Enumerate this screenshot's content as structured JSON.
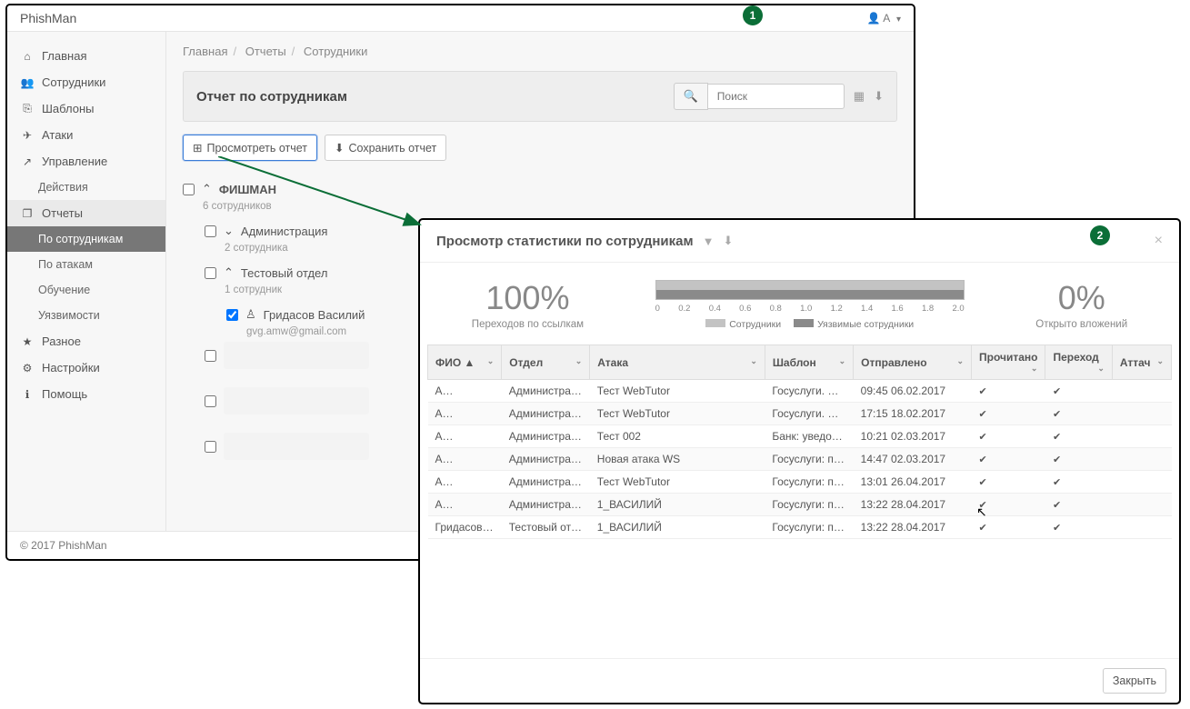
{
  "app": {
    "title": "PhishMan",
    "user_prefix": "A",
    "footer": "© 2017 PhishMan"
  },
  "badges": {
    "b1": "1",
    "b2": "2"
  },
  "breadcrumb": [
    "Главная",
    "Отчеты",
    "Сотрудники"
  ],
  "sidebar": {
    "items": [
      {
        "label": "Главная",
        "icon": "⌂"
      },
      {
        "label": "Сотрудники",
        "icon": "👥"
      },
      {
        "label": "Шаблоны",
        "icon": "⎘"
      },
      {
        "label": "Атаки",
        "icon": "✈"
      },
      {
        "label": "Управление",
        "icon": "↗"
      },
      {
        "label": "Действия",
        "sub": true
      },
      {
        "label": "Отчеты",
        "icon": "❐",
        "activeParent": true
      },
      {
        "label": "По сотрудникам",
        "sub": true,
        "active": true
      },
      {
        "label": "По атакам",
        "sub": true
      },
      {
        "label": "Обучение",
        "sub": true
      },
      {
        "label": "Уязвимости",
        "sub": true
      },
      {
        "label": "Разное",
        "icon": "★"
      },
      {
        "label": "Настройки",
        "icon": "⚙"
      },
      {
        "label": "Помощь",
        "icon": "ℹ"
      }
    ]
  },
  "panel": {
    "title": "Отчет по сотрудникам",
    "search_placeholder": "Поиск",
    "btn_preview": "Просмотреть отчет",
    "btn_save": "Сохранить отчет"
  },
  "tree": {
    "root": {
      "label": "ФИШМАН",
      "count": "6 сотрудников"
    },
    "admin": {
      "label": "Администрация",
      "count": "2 сотрудника"
    },
    "test": {
      "label": "Тестовый отдел",
      "count": "1 сотрудник"
    },
    "emp": {
      "label": "Гридасов Василий",
      "email": "gvg.amw@gmail.com"
    }
  },
  "modal": {
    "title": "Просмотр статистики по сотрудникам",
    "close_btn": "Закрыть",
    "stat_left_val": "100%",
    "stat_left_lbl": "Переходов по ссылкам",
    "stat_right_val": "0%",
    "stat_right_lbl": "Открыто вложений",
    "legend": {
      "a": "Сотрудники",
      "b": "Уязвимые сотрудники"
    },
    "columns": [
      "ФИО ▲",
      "Отдел",
      "Атака",
      "Шаблон",
      "Отправлено",
      "Прочитано",
      "Переход",
      "Аттач"
    ],
    "rows": [
      {
        "fio": "А…",
        "dept": "Администрац…",
        "attack": "Тест WebTutor",
        "tpl": "Госуслуги. Ш…",
        "sent": "09:45 06.02.2017",
        "read": true,
        "click": true,
        "att": false
      },
      {
        "fio": "А…",
        "dept": "Администрац…",
        "attack": "Тест WebTutor",
        "tpl": "Госуслуги. Ш…",
        "sent": "17:15 18.02.2017",
        "read": true,
        "click": true,
        "att": false
      },
      {
        "fio": "А…",
        "dept": "Администрац…",
        "attack": "Тест 002",
        "tpl": "Банк: уведом…",
        "sent": "10:21 02.03.2017",
        "read": true,
        "click": true,
        "att": false
      },
      {
        "fio": "А…",
        "dept": "Администрац…",
        "attack": "Новая атака WS",
        "tpl": "Госуслуги: п…",
        "sent": "14:47 02.03.2017",
        "read": true,
        "click": true,
        "att": false
      },
      {
        "fio": "А…",
        "dept": "Администрац…",
        "attack": "Тест WebTutor",
        "tpl": "Госуслуги: п…",
        "sent": "13:01 26.04.2017",
        "read": true,
        "click": true,
        "att": false
      },
      {
        "fio": "А…",
        "dept": "Администрац…",
        "attack": "1_ВАСИЛИЙ",
        "tpl": "Госуслуги: п…",
        "sent": "13:22 28.04.2017",
        "read": true,
        "click": true,
        "att": false
      },
      {
        "fio": "Гридасов Ва…",
        "dept": "Тестовый от…",
        "attack": "1_ВАСИЛИЙ",
        "tpl": "Госуслуги: п…",
        "sent": "13:22 28.04.2017",
        "read": true,
        "click": true,
        "att": false
      }
    ]
  },
  "chart_data": {
    "type": "bar",
    "title": "",
    "xlabel": "",
    "ylabel": "",
    "xlim": [
      0,
      2.0
    ],
    "ticks": [
      "0",
      "0.2",
      "0.4",
      "0.6",
      "0.8",
      "1.0",
      "1.2",
      "1.4",
      "1.6",
      "1.8",
      "2.0"
    ],
    "series": [
      {
        "name": "Сотрудники",
        "values": [
          2.0
        ]
      },
      {
        "name": "Уязвимые сотрудники",
        "values": [
          2.0
        ]
      }
    ]
  }
}
